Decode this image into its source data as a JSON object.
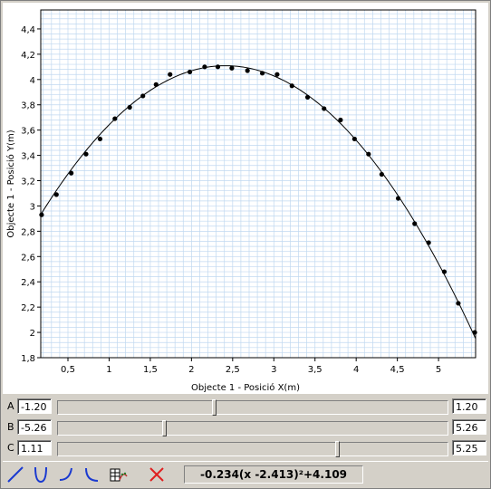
{
  "chart_data": {
    "type": "scatter",
    "xlabel": "Objecte 1 - Posició X(m)",
    "ylabel": "Objecte 1 - Posició Y(m)",
    "xlim": [
      0.17,
      5.45
    ],
    "ylim": [
      1.8,
      4.55
    ],
    "x_ticks": [
      {
        "v": 0.5,
        "label": "0,5"
      },
      {
        "v": 1,
        "label": "1"
      },
      {
        "v": 1.5,
        "label": "1,5"
      },
      {
        "v": 2,
        "label": "2"
      },
      {
        "v": 2.5,
        "label": "2,5"
      },
      {
        "v": 3,
        "label": "3"
      },
      {
        "v": 3.5,
        "label": "3,5"
      },
      {
        "v": 4,
        "label": "4"
      },
      {
        "v": 4.5,
        "label": "4,5"
      },
      {
        "v": 5,
        "label": "5"
      }
    ],
    "y_ticks": [
      {
        "v": 1.8,
        "label": "1,8"
      },
      {
        "v": 2,
        "label": "2"
      },
      {
        "v": 2.2,
        "label": "2,2"
      },
      {
        "v": 2.4,
        "label": "2,4"
      },
      {
        "v": 2.6,
        "label": "2,6"
      },
      {
        "v": 2.8,
        "label": "2,8"
      },
      {
        "v": 3,
        "label": "3"
      },
      {
        "v": 3.2,
        "label": "3,2"
      },
      {
        "v": 3.4,
        "label": "3,4"
      },
      {
        "v": 3.6,
        "label": "3,6"
      },
      {
        "v": 3.8,
        "label": "3,8"
      },
      {
        "v": 4,
        "label": "4"
      },
      {
        "v": 4.2,
        "label": "4,2"
      },
      {
        "v": 4.4,
        "label": "4,4"
      }
    ],
    "grid": true,
    "points": [
      [
        0.18,
        2.93
      ],
      [
        0.36,
        3.09
      ],
      [
        0.54,
        3.26
      ],
      [
        0.72,
        3.41
      ],
      [
        0.89,
        3.53
      ],
      [
        1.07,
        3.69
      ],
      [
        1.25,
        3.78
      ],
      [
        1.41,
        3.87
      ],
      [
        1.57,
        3.96
      ],
      [
        1.74,
        4.04
      ],
      [
        1.98,
        4.06
      ],
      [
        2.16,
        4.1
      ],
      [
        2.32,
        4.1
      ],
      [
        2.49,
        4.09
      ],
      [
        2.68,
        4.07
      ],
      [
        2.86,
        4.05
      ],
      [
        3.04,
        4.04
      ],
      [
        3.22,
        3.95
      ],
      [
        3.41,
        3.86
      ],
      [
        3.61,
        3.77
      ],
      [
        3.81,
        3.68
      ],
      [
        3.98,
        3.53
      ],
      [
        4.15,
        3.41
      ],
      [
        4.31,
        3.25
      ],
      [
        4.51,
        3.06
      ],
      [
        4.71,
        2.86
      ],
      [
        4.88,
        2.71
      ],
      [
        5.07,
        2.48
      ],
      [
        5.24,
        2.23
      ],
      [
        5.44,
        2.0
      ]
    ],
    "fit": {
      "a": -0.234,
      "h": 2.413,
      "k": 4.109
    }
  },
  "sliders": [
    {
      "label": "A",
      "min": "-1.20",
      "max": "1.20",
      "position": 0.4
    },
    {
      "label": "B",
      "min": "-5.26",
      "max": "5.26",
      "position": 0.27
    },
    {
      "label": "C",
      "min": "1.11",
      "max": "5.25",
      "position": 0.72
    }
  ],
  "toolbar": {
    "formula": "-0.234(x -2.413)²+4.109",
    "buttons": [
      "linear-fit-icon",
      "parabola-fit-icon",
      "exponential-fit-icon",
      "power-fit-icon",
      "table-fit-icon",
      "delete-fit-icon"
    ]
  },
  "colors": {
    "grid": "#c0d8f0",
    "axis": "#000000",
    "points": "#000000"
  }
}
